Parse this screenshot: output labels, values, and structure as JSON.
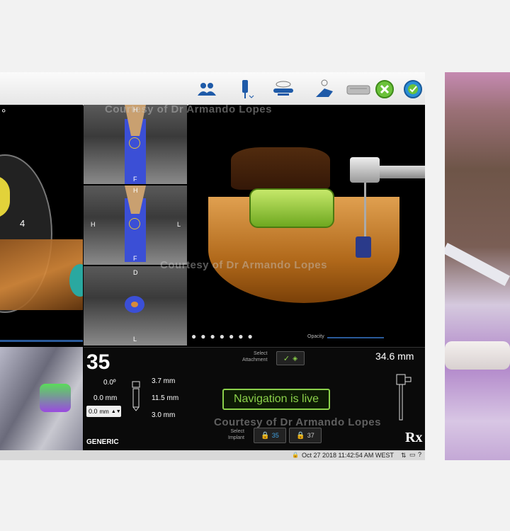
{
  "watermark": "Courtesy of Dr Armando Lopes",
  "toolbar": {
    "icons": [
      "users-icon",
      "drill-handpiece-icon",
      "scanner-tray-icon",
      "tracker-icon",
      "tray-icon",
      "cancel-circle-icon",
      "check-circle-icon"
    ]
  },
  "left_panel": {
    "degree_label": "°",
    "scale_label": "4"
  },
  "slices": {
    "top_label": "H",
    "bottom_label": "F",
    "left_label": "H",
    "right_label": "L",
    "axial_top": "D",
    "axial_bottom": "L"
  },
  "view3d": {
    "bottom_label": "Opacity"
  },
  "info": {
    "tooth_number": "35",
    "angle_label": "0.0º",
    "depth_label": "0.0 mm",
    "length_diameter": "3.7 mm",
    "length_mid": "11.5 mm",
    "length_bottom": "3.0 mm",
    "offset_value": "0.0",
    "offset_unit": "mm",
    "generic_label": "GENERIC",
    "select_attachment": "Select\nAttachment",
    "navigation_status": "Navigation is live",
    "select_implant": "Select\nImplant",
    "implant_a": "35",
    "implant_b": "37",
    "drill_depth": "34.6 mm",
    "rx_label": "Rx"
  },
  "status": {
    "datetime": "Oct 27 2018 11:42:54 AM WEST"
  },
  "colors": {
    "accent_green": "#8bd14a",
    "implant_blue": "#3b4fd6",
    "guide_green": "#9fd34a",
    "bone": "#c07a2a"
  }
}
